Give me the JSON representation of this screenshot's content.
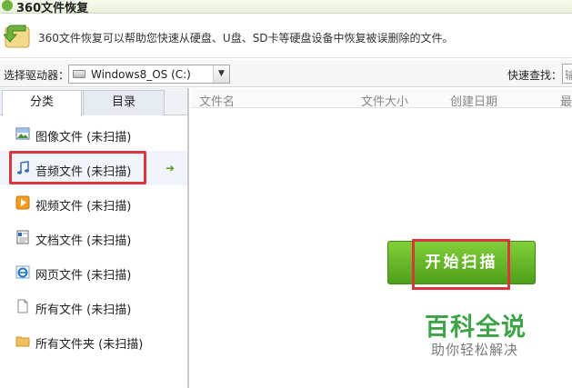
{
  "window": {
    "title": "360文件恢复"
  },
  "banner": {
    "description": "360文件恢复可以帮助您快速从硬盘、U盘、SD卡等硬盘设备中恢复被误删除的文件。"
  },
  "toolbar": {
    "drive_label": "选择驱动器：",
    "drive_value": "Windows8_OS (C:)",
    "quick_search_label": "快速查找：",
    "quick_search_value": "输"
  },
  "sidebar": {
    "tabs": [
      {
        "label": "分类",
        "active": true
      },
      {
        "label": "目录",
        "active": false
      }
    ],
    "categories": [
      {
        "label": "图像文件 (未扫描)",
        "icon": "image-icon"
      },
      {
        "label": "音频文件 (未扫描)",
        "icon": "music-note-icon",
        "selected": true,
        "go_icon": "green-arrow-right-icon"
      },
      {
        "label": "视频文件 (未扫描)",
        "icon": "video-icon"
      },
      {
        "label": "文档文件 (未扫描)",
        "icon": "document-icon"
      },
      {
        "label": "网页文件 (未扫描)",
        "icon": "ie-icon"
      },
      {
        "label": "所有文件 (未扫描)",
        "icon": "file-icon"
      },
      {
        "label": "所有文件夹 (未扫描)",
        "icon": "folder-icon"
      }
    ]
  },
  "main": {
    "columns": [
      "文件名",
      "文件大小",
      "创建日期",
      "最"
    ],
    "scan_button": "开始扫描"
  },
  "watermark": {
    "main": "百科全说",
    "sub": "助你轻松解决"
  },
  "colors": {
    "accent_green": "#5aab22",
    "highlight_red": "#d9363e",
    "watermark_green": "#3fa447"
  }
}
